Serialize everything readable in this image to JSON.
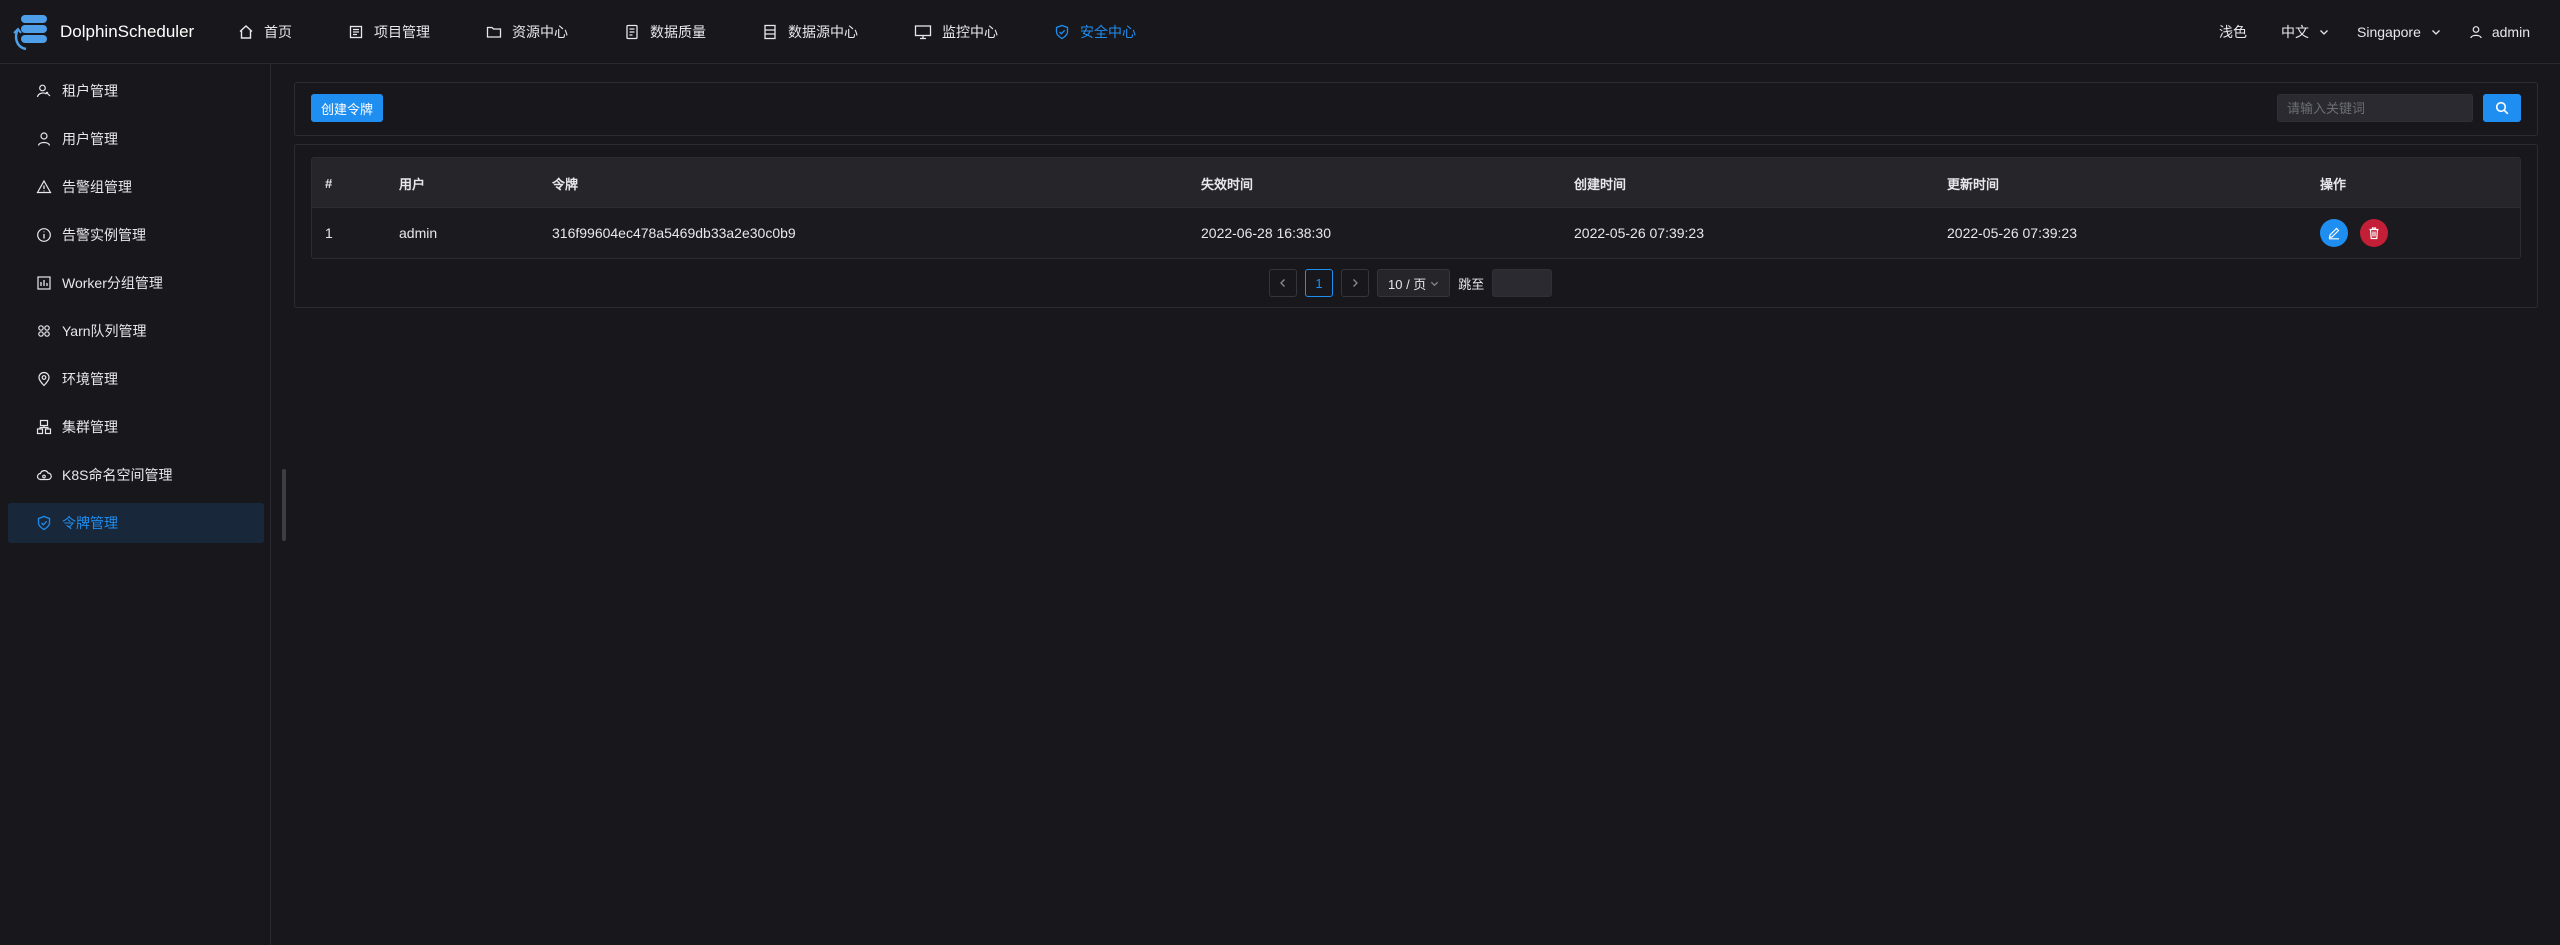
{
  "app": {
    "name": "DolphinScheduler"
  },
  "nav": [
    {
      "label": "首页",
      "icon": "home-icon",
      "active": false
    },
    {
      "label": "项目管理",
      "icon": "project-icon",
      "active": false
    },
    {
      "label": "资源中心",
      "icon": "folder-icon",
      "active": false
    },
    {
      "label": "数据质量",
      "icon": "data-quality-icon",
      "active": false
    },
    {
      "label": "数据源中心",
      "icon": "datasource-icon",
      "active": false
    },
    {
      "label": "监控中心",
      "icon": "monitor-icon",
      "active": false
    },
    {
      "label": "安全中心",
      "icon": "shield-check-icon",
      "active": true
    }
  ],
  "header_right": {
    "theme": "浅色",
    "language": "中文",
    "timezone": "Singapore",
    "user": "admin"
  },
  "sidebar": [
    {
      "label": "租户管理",
      "icon": "tenant-icon",
      "active": false
    },
    {
      "label": "用户管理",
      "icon": "user-icon",
      "active": false
    },
    {
      "label": "告警组管理",
      "icon": "warning-icon",
      "active": false
    },
    {
      "label": "告警实例管理",
      "icon": "info-icon",
      "active": false
    },
    {
      "label": "Worker分组管理",
      "icon": "worker-group-icon",
      "active": false
    },
    {
      "label": "Yarn队列管理",
      "icon": "yarn-icon",
      "active": false
    },
    {
      "label": "环境管理",
      "icon": "location-icon",
      "active": false
    },
    {
      "label": "集群管理",
      "icon": "cluster-icon",
      "active": false
    },
    {
      "label": "K8S命名空间管理",
      "icon": "cloud-icon",
      "active": false
    },
    {
      "label": "令牌管理",
      "icon": "shield-check-icon",
      "active": true
    }
  ],
  "toolbar": {
    "create_label": "创建令牌",
    "search_placeholder": "请输入关键词"
  },
  "table": {
    "columns": [
      "#",
      "用户",
      "令牌",
      "失效时间",
      "创建时间",
      "更新时间",
      "操作"
    ],
    "rows": [
      {
        "index": "1",
        "user": "admin",
        "token": "316f99604ec478a5469db33a2e30c0b9",
        "expire_time": "2022-06-28 16:38:30",
        "create_time": "2022-05-26 07:39:23",
        "update_time": "2022-05-26 07:39:23"
      }
    ]
  },
  "pagination": {
    "current_page": "1",
    "page_size_label": "10 / 页",
    "jump_label": "跳至"
  },
  "colors": {
    "accent": "#1f8ef1",
    "danger": "#c31f37",
    "background": "#18181c"
  }
}
